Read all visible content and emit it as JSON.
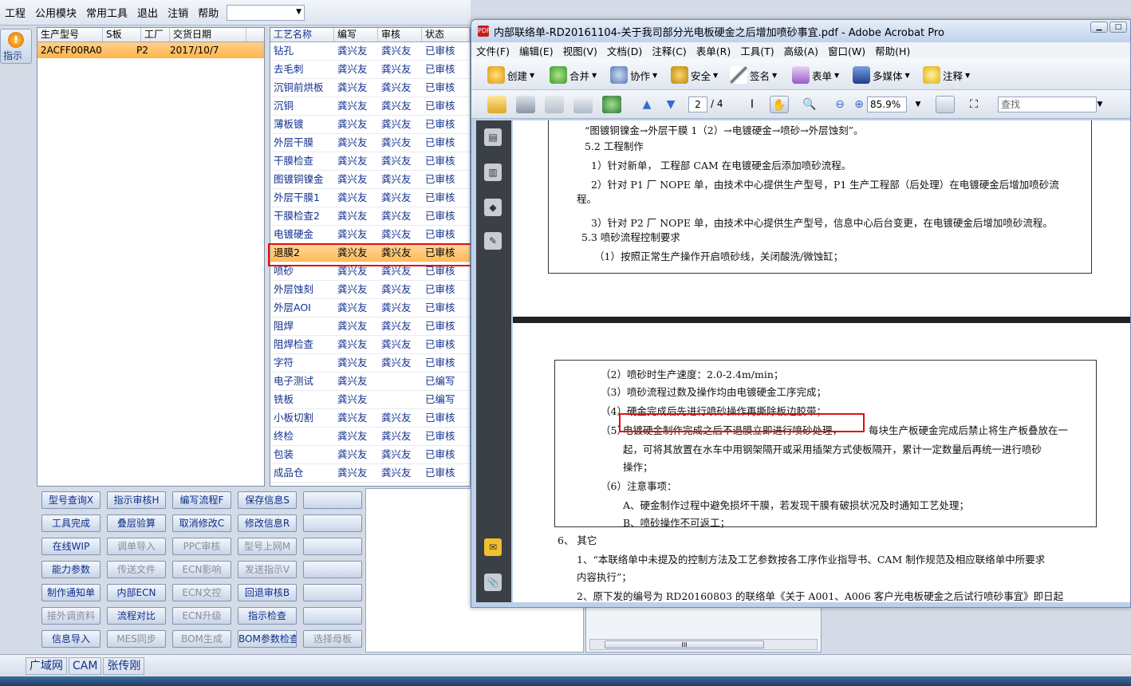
{
  "menubar": {
    "items": [
      "工程",
      "公用模块",
      "常用工具",
      "退出",
      "注销",
      "帮助"
    ]
  },
  "guide": {
    "label": "指示"
  },
  "orders": {
    "headers": [
      "生产型号",
      "S板",
      "工厂",
      "交货日期"
    ],
    "row": [
      "2ACFF00RA0",
      "",
      "P2",
      "2017/10/7"
    ]
  },
  "process": {
    "headers": [
      "工艺名称",
      "编写",
      "审核",
      "状态"
    ],
    "rows": [
      [
        "钻孔",
        "龚兴友",
        "龚兴友",
        "已审核"
      ],
      [
        "去毛刺",
        "龚兴友",
        "龚兴友",
        "已审核"
      ],
      [
        "沉铜前烘板",
        "龚兴友",
        "龚兴友",
        "已审核"
      ],
      [
        "沉铜",
        "龚兴友",
        "龚兴友",
        "已审核"
      ],
      [
        "薄板镀",
        "龚兴友",
        "龚兴友",
        "已审核"
      ],
      [
        "外层干膜",
        "龚兴友",
        "龚兴友",
        "已审核"
      ],
      [
        "干膜检查",
        "龚兴友",
        "龚兴友",
        "已审核"
      ],
      [
        "图镀铜镍金",
        "龚兴友",
        "龚兴友",
        "已审核"
      ],
      [
        "外层干膜1",
        "龚兴友",
        "龚兴友",
        "已审核"
      ],
      [
        "干膜检查2",
        "龚兴友",
        "龚兴友",
        "已审核"
      ],
      [
        "电镀硬金",
        "龚兴友",
        "龚兴友",
        "已审核"
      ],
      [
        "退膜2",
        "龚兴友",
        "龚兴友",
        "已审核"
      ],
      [
        "喷砂",
        "龚兴友",
        "龚兴友",
        "已审核"
      ],
      [
        "外层蚀刻",
        "龚兴友",
        "龚兴友",
        "已审核"
      ],
      [
        "外层AOI",
        "龚兴友",
        "龚兴友",
        "已审核"
      ],
      [
        "阻焊",
        "龚兴友",
        "龚兴友",
        "已审核"
      ],
      [
        "阻焊检查",
        "龚兴友",
        "龚兴友",
        "已审核"
      ],
      [
        "字符",
        "龚兴友",
        "龚兴友",
        "已审核"
      ],
      [
        "电子测试",
        "龚兴友",
        "",
        "已编写"
      ],
      [
        "铣板",
        "龚兴友",
        "",
        "已编写"
      ],
      [
        "小板切割",
        "龚兴友",
        "龚兴友",
        "已审核"
      ],
      [
        "终检",
        "龚兴友",
        "龚兴友",
        "已审核"
      ],
      [
        "包装",
        "龚兴友",
        "龚兴友",
        "已审核"
      ],
      [
        "成品仓",
        "龚兴友",
        "龚兴友",
        "已审核"
      ]
    ]
  },
  "buttons": {
    "row1": [
      "型号查询X",
      "指示审核H",
      "编写流程F",
      "保存信息S",
      ""
    ],
    "row2": [
      "工具完成",
      "叠层验算",
      "取消修改C",
      "修改信息R",
      ""
    ],
    "row3": [
      "在线WIP",
      "调单导入",
      "PPC审核",
      "型号上网M",
      ""
    ],
    "row4": [
      "能力参数",
      "传送文件",
      "ECN影响",
      "发送指示V",
      ""
    ],
    "row5": [
      "制作通知单",
      "内部ECN",
      "ECN文控",
      "回退审核B",
      ""
    ],
    "row6": [
      "接外调资料",
      "流程对比",
      "ECN升级",
      "指示检查",
      ""
    ],
    "row7": [
      "信息导入",
      "MES同步",
      "BOM生成",
      "BOM参数检查",
      "选择母板"
    ]
  },
  "statusbar": {
    "items": [
      "广域网",
      "CAM",
      "张传刚"
    ]
  },
  "acrobat": {
    "title": "内部联络单-RD20161104-关于我司部分光电板硬金之后增加喷砂事宜.pdf - Adobe Acrobat Pro",
    "menu": [
      "文件(F)",
      "编辑(E)",
      "视图(V)",
      "文档(D)",
      "注释(C)",
      "表单(R)",
      "工具(T)",
      "高级(A)",
      "窗口(W)",
      "帮助(H)"
    ],
    "toolbar": [
      "创建",
      "合并",
      "协作",
      "安全",
      "签名",
      "表单",
      "多媒体",
      "注释"
    ],
    "page_current": "2",
    "page_total": "/ 4",
    "zoom": "85.9%",
    "find_placeholder": "查找",
    "page1_lines": [
      "“图镀铜镍金→外层干膜 1（2）→电镀硬金→喷砂→外层蚀刻”。",
      "5.2  工程制作",
      "1）针对新单， 工程部 CAM 在电镀硬金后添加喷砂流程。",
      "2）针对 P1 厂 NOPE 单，由技术中心提供生产型号，P1 生产工程部（后处理）在电镀硬金后增加喷砂流",
      "程。",
      "3）针对 P2 厂 NOPE 单，由技术中心提供生产型号，信息中心后台变更，在电镀硬金后增加喷砂流程。",
      "5.3 喷砂流程控制要求",
      "（1）按照正常生产操作开启喷砂线，关闭酸洗/微蚀缸；"
    ],
    "page2_lines": [
      "（2）喷砂时生产速度：2.0-2.4m/min；",
      "（3）喷砂流程过数及操作均由电镀硬金工序完成；",
      "（4）硬金完成后先进行喷砂操作再撕除板边胶带；",
      "（5）",
      "电镀硬金制作完成之后不退膜立即进行喷砂处理，",
      "每块生产板硬金完成后禁止将生产板叠放在一",
      "起，可将其放置在水车中用钢架隔开或采用插架方式使板隔开，累计一定数量后再统一进行喷砂",
      "操作；",
      "（6）注意事项：",
      "A、硬金制作过程中避免损坏干膜，若发现干膜有破损状况及时通知工艺处理；",
      "B、喷砂操作不可返工；",
      "6、 其它",
      "1、“本联络单中未提及的控制方法及工艺参数按各工序作业指导书、CAM 制作规范及相应联络单中所要求",
      "内容执行”；",
      "2、原下发的编号为 RD20160803 的联络单《关于 A001、A006 客户光电板硬金之后试行喷砂事宜》即日起"
    ]
  },
  "colors": {
    "accent": "#e01010",
    "link": "#12308f",
    "selected_row": "#ffb957"
  }
}
